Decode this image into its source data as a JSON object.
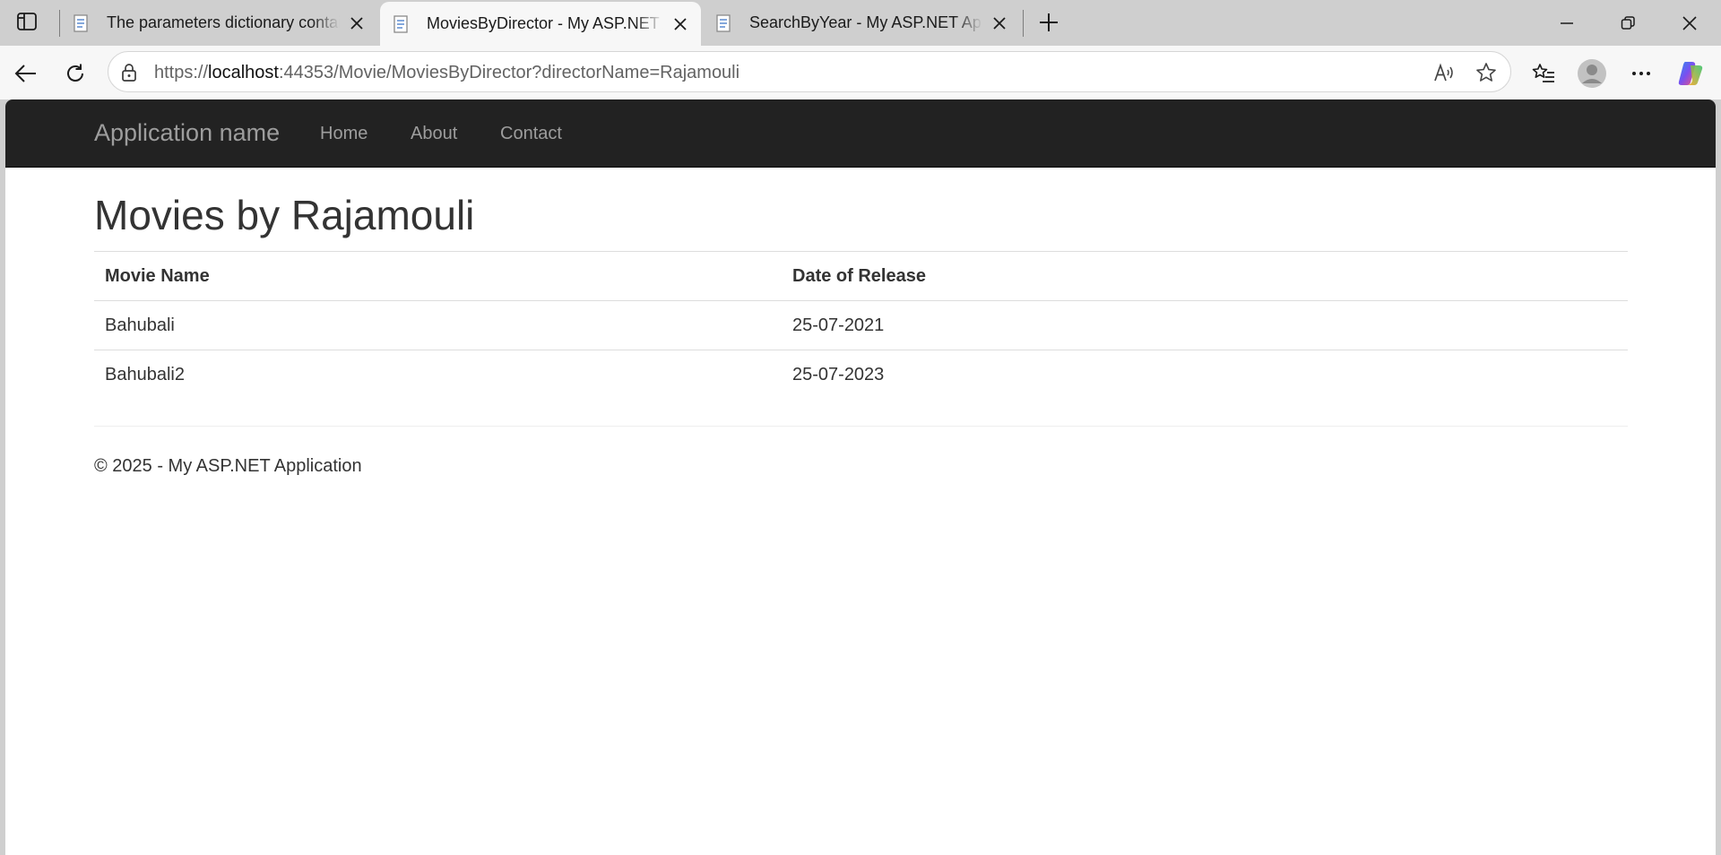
{
  "browser": {
    "tabs": [
      {
        "title": "The parameters dictionary contains a null entry",
        "active": false
      },
      {
        "title": "MoviesByDirector - My ASP.NET Application",
        "active": true
      },
      {
        "title": "SearchByYear - My ASP.NET Application",
        "active": false
      }
    ],
    "address": {
      "scheme": "https://",
      "host": "localhost",
      "path": ":44353/Movie/MoviesByDirector?directorName=Rajamouli"
    },
    "icons": {
      "tab_actions": "tab-actions-icon",
      "new_tab": "plus-icon",
      "back": "back-arrow-icon",
      "refresh": "refresh-icon",
      "lock": "lock-icon",
      "read_aloud": "read-aloud-icon",
      "favorite": "star-icon",
      "favorites": "favorites-list-icon",
      "profile": "profile-avatar-icon",
      "more": "more-dots-icon",
      "copilot": "copilot-icon"
    }
  },
  "site": {
    "brand": "Application name",
    "nav": [
      {
        "label": "Home"
      },
      {
        "label": "About"
      },
      {
        "label": "Contact"
      }
    ],
    "colors": {
      "navbar": "#222222",
      "nav_text": "#9d9d9d",
      "body_text": "#333333"
    }
  },
  "page": {
    "heading": "Movies by Rajamouli",
    "table": {
      "headers": [
        "Movie Name",
        "Date of Release"
      ],
      "rows": [
        [
          "Bahubali",
          "25-07-2021"
        ],
        [
          "Bahubali2",
          "25-07-2023"
        ]
      ]
    },
    "footer": "© 2025 - My ASP.NET Application"
  }
}
